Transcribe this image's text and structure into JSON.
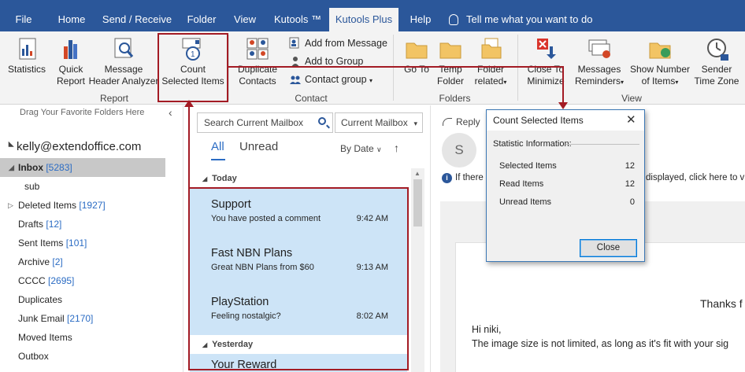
{
  "tabs": [
    "File",
    "Home",
    "Send / Receive",
    "Folder",
    "View",
    "Kutools ™",
    "Kutools Plus",
    "Help"
  ],
  "tell_me": "Tell me what you want to do",
  "ribbon": {
    "statistics": "Statistics",
    "quick_report": "Quick\nReport",
    "message_header_analyzer": "Message\nHeader Analyzer",
    "report_group": "Report",
    "count_selected_items": "Count\nSelected Items",
    "duplicate_contacts": "Duplicate\nContacts",
    "add_from_message": "Add from Message",
    "add_to_group": "Add to Group",
    "contact_group": "Contact group",
    "contact_group_label": "Contact",
    "go_to": "Go To",
    "temp_folder": "Temp\nFolder",
    "folder_related": "Folder\nrelated",
    "folders_group": "Folders",
    "close_to_minimize": "Close To\nMinimize",
    "messages_reminders": "Messages\nReminders",
    "show_number_of_items": "Show Number\nof Items",
    "sender_time_zone": "Sender\nTime Zone",
    "view_group": "View"
  },
  "folder_pane": {
    "favorites_hint": "Drag Your Favorite Folders Here",
    "account": "kelly@extendoffice.com",
    "folders": [
      {
        "name": "Inbox",
        "count": "[5283]"
      },
      {
        "name": "sub",
        "count": ""
      },
      {
        "name": "Deleted Items",
        "count": "[1927]"
      },
      {
        "name": "Drafts",
        "count": "[12]"
      },
      {
        "name": "Sent Items",
        "count": "[101]"
      },
      {
        "name": "Archive",
        "count": "[2]"
      },
      {
        "name": "CCCC",
        "count": "[2695]"
      },
      {
        "name": "Duplicates",
        "count": ""
      },
      {
        "name": "Junk Email",
        "count": "[2170]"
      },
      {
        "name": "Moved Items",
        "count": ""
      },
      {
        "name": "Outbox",
        "count": ""
      }
    ]
  },
  "message_list": {
    "search_placeholder": "Search Current Mailbox",
    "scope": "Current Mailbox",
    "filter_all": "All",
    "filter_unread": "Unread",
    "sort": "By Date",
    "group_today": "Today",
    "group_yesterday": "Yesterday",
    "messages": [
      {
        "from": "Support",
        "subject": "You have posted a comment",
        "time": "9:42 AM"
      },
      {
        "from": "Fast NBN Plans",
        "subject": "Great NBN Plans from $60",
        "time": "9:13 AM"
      },
      {
        "from": "PlayStation",
        "subject": "Feeling nostalgic?",
        "time": "8:02 AM"
      },
      {
        "from": "Your Reward",
        "subject": "",
        "time": ""
      }
    ]
  },
  "reading_pane": {
    "reply": "Reply",
    "avatar_letter": "S",
    "info_start": "If there",
    "info_end": "displayed, click here to v",
    "thanks": "Thanks f",
    "greeting": "Hi niki,",
    "body_line": "The image size is not limited, as long as it's fit with your sig"
  },
  "dialog": {
    "title": "Count Selected Items",
    "statistic_label": "Statistic Information:",
    "rows": [
      {
        "label": "Selected Items",
        "value": "12"
      },
      {
        "label": "Read Items",
        "value": "12"
      },
      {
        "label": "Unread Items",
        "value": "0"
      }
    ],
    "close_button": "Close"
  },
  "colors": {
    "ribbon_blue": "#2b579a",
    "selection_blue": "#cde4f7",
    "annotation_red": "#a31b24",
    "count_blue": "#2b6cc4"
  }
}
